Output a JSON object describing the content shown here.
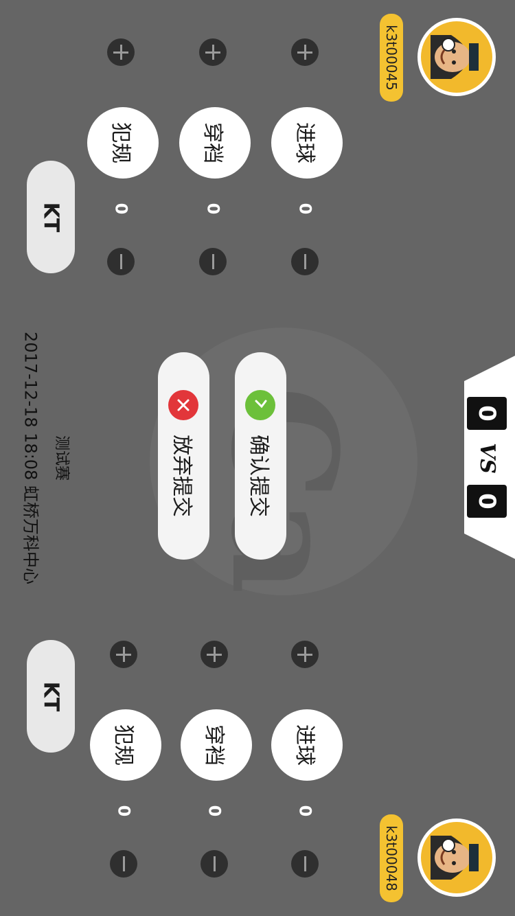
{
  "match": {
    "title": "测试赛",
    "datetime_location": "2017-12-18 18:08 虹桥万科中心"
  },
  "score": {
    "home": "0",
    "vs": "VS",
    "away": "0"
  },
  "actions": {
    "confirm": "确认提交",
    "abandon": "放弃提交"
  },
  "teams": [
    {
      "username": "k3t00045",
      "kt_label": "KT",
      "stats": [
        {
          "label": "进球",
          "count": "0"
        },
        {
          "label": "穿裆",
          "count": "0"
        },
        {
          "label": "犯规",
          "count": "0"
        }
      ]
    },
    {
      "username": "k3t00048",
      "kt_label": "KT",
      "stats": [
        {
          "label": "进球",
          "count": "0"
        },
        {
          "label": "穿裆",
          "count": "0"
        },
        {
          "label": "犯规",
          "count": "0"
        }
      ]
    }
  ],
  "colors": {
    "background": "#656565",
    "confirm_icon": "#6cc03a",
    "abandon_icon": "#e2363a",
    "name_tag": "#f4c231"
  },
  "icons": {
    "plus": "plus-icon",
    "minus": "minus-icon",
    "check": "check-icon",
    "close": "close-icon"
  }
}
